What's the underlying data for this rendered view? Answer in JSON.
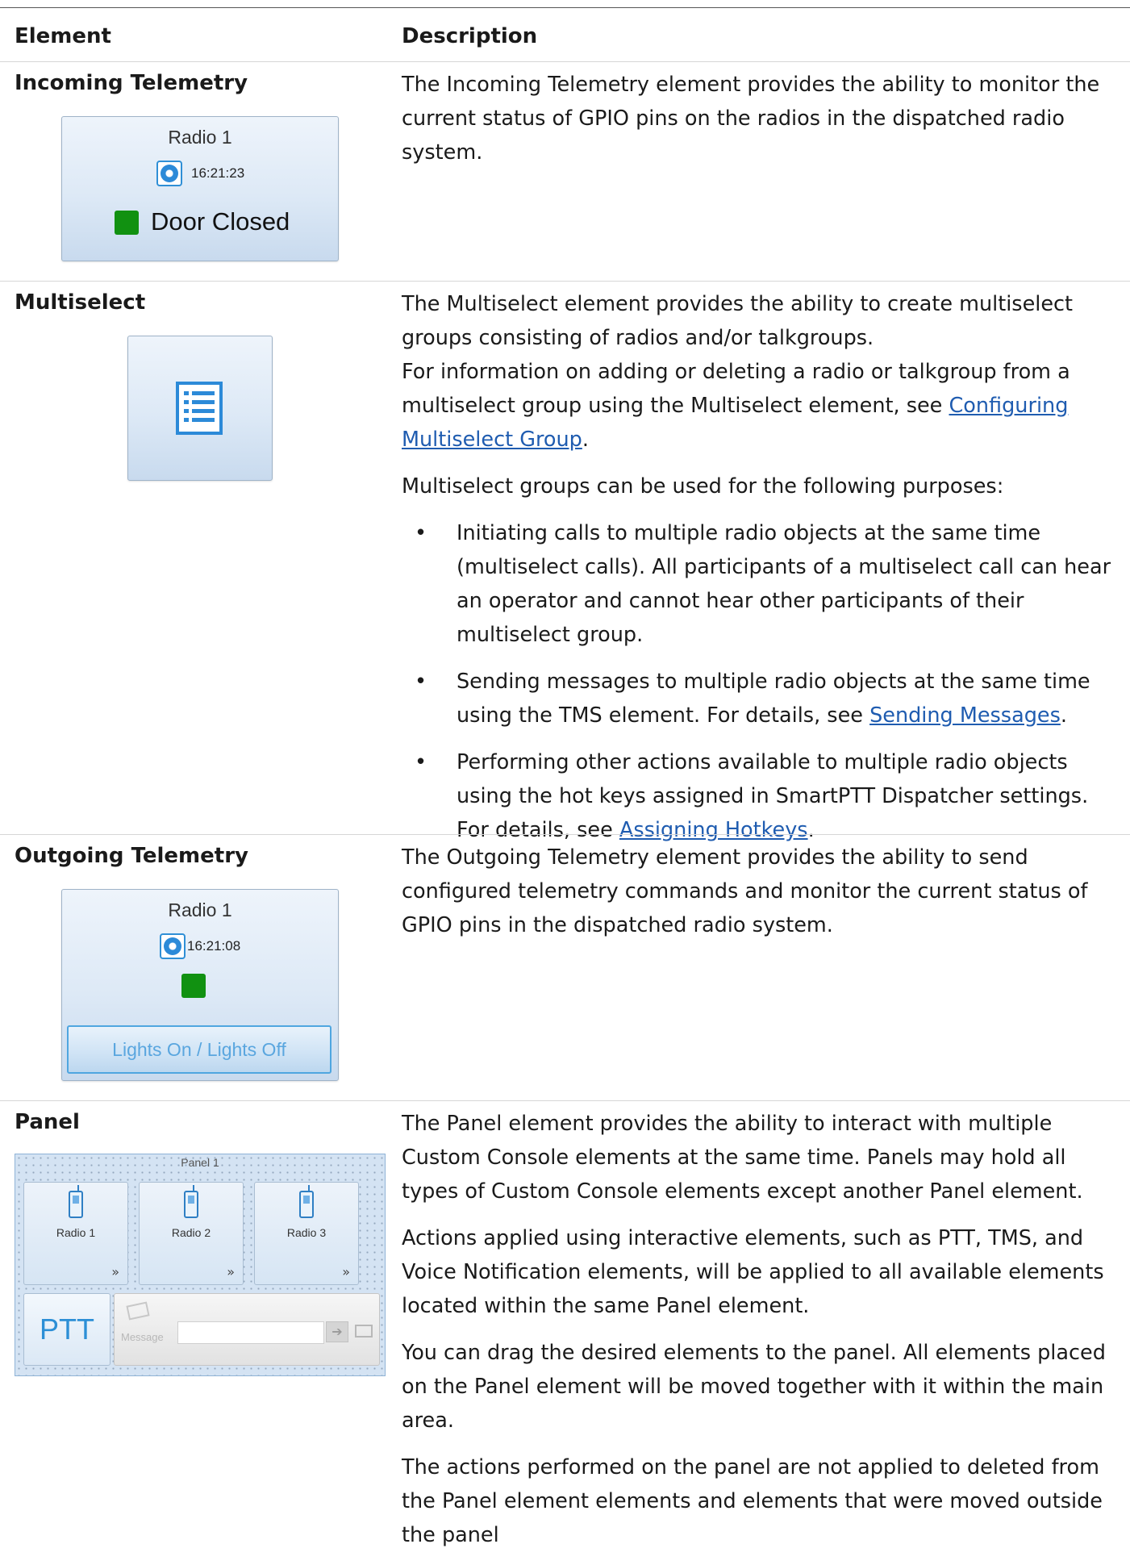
{
  "table": {
    "header_element": "Element",
    "header_description": "Description"
  },
  "incoming": {
    "name": "Incoming Telemetry",
    "widget": {
      "radio": "Radio 1",
      "time": "16:21:23",
      "status": "Door Closed",
      "led_color": "#119111"
    },
    "desc": "The Incoming Telemetry element provides the ability to monitor the current status of GPIO pins on the radios in the dispatched radio system."
  },
  "multiselect": {
    "name": "Multiselect",
    "desc1": "The Multiselect element provides the ability to create multiselect groups consisting of radios and/or talkgroups.",
    "desc2_prefix": "For information on adding or deleting a radio or talkgroup from a multiselect group using the Multiselect element, see ",
    "desc2_link": "Configuring Multiselect Group",
    "desc2_suffix": ".",
    "desc3": "Multiselect groups can be used for the following purposes:",
    "bullet_char": "•",
    "bullet1": "Initiating calls to multiple radio objects at the same time (multiselect calls). All participants of a multiselect call can hear an operator and cannot hear other participants of their multiselect group.",
    "bullet2_prefix": "Sending messages to multiple radio objects at the same time using the TMS element. For details, see ",
    "bullet2_link": "Sending Messages",
    "bullet2_suffix": ".",
    "bullet3_prefix": "Performing other actions available to multiple radio objects using the hot keys assigned in SmartPTT Dispatcher settings. For details, see ",
    "bullet3_link": "Assigning Hotkeys",
    "bullet3_suffix": "."
  },
  "outgoing": {
    "name": "Outgoing Telemetry",
    "widget": {
      "radio": "Radio 1",
      "time": "16:21:08",
      "command": "Lights On / Lights Off",
      "led_color": "#119111"
    },
    "desc": "The Outgoing Telemetry element provides the ability to send configured telemetry commands and monitor the current status of GPIO pins in the dispatched radio system."
  },
  "panel": {
    "name": "Panel",
    "widget": {
      "title": "Panel 1",
      "radios": [
        "Radio 1",
        "Radio 2",
        "Radio 3"
      ],
      "chevron": "»",
      "ptt": "PTT",
      "message_label": "Message",
      "send_arrow": "➔"
    },
    "desc1": "The Panel element provides the ability to interact with multiple Custom Console elements at the same time. Panels may hold all types of Custom Console elements except another Panel element.",
    "desc2": "Actions applied using interactive elements, such as PTT, TMS, and Voice Notification elements, will be applied to all available elements located within the same Panel element.",
    "desc3": "You can drag the desired elements to the panel. All elements placed on the Panel element will be moved together with it within the main area.",
    "desc4": "The actions performed on the panel are not applied to deleted from the Panel element elements and elements that were moved outside the panel"
  }
}
